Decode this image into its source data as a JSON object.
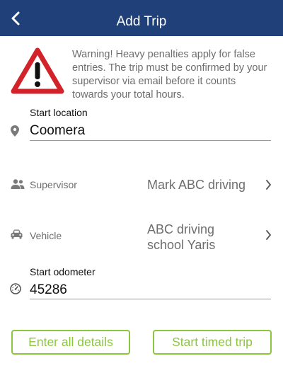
{
  "header": {
    "title": "Add Trip"
  },
  "warning": {
    "text": "Warning! Heavy penalties apply for false entries. The trip must be confirmed by your supervisor via email before it counts towards your total hours."
  },
  "start_location": {
    "label": "Start location",
    "value": "Coomera"
  },
  "supervisor": {
    "label": "Supervisor",
    "value": "Mark ABC driving"
  },
  "vehicle": {
    "label": "Vehicle",
    "value_line1": "ABC driving",
    "value_line2": "school Yaris"
  },
  "start_odometer": {
    "label": "Start odometer",
    "value": "45286"
  },
  "buttons": {
    "enter_details": "Enter all details",
    "start_timed": "Start timed trip"
  },
  "colors": {
    "header": "#20407a",
    "accent": "#8cc63f",
    "warning_red": "#d2232a"
  }
}
